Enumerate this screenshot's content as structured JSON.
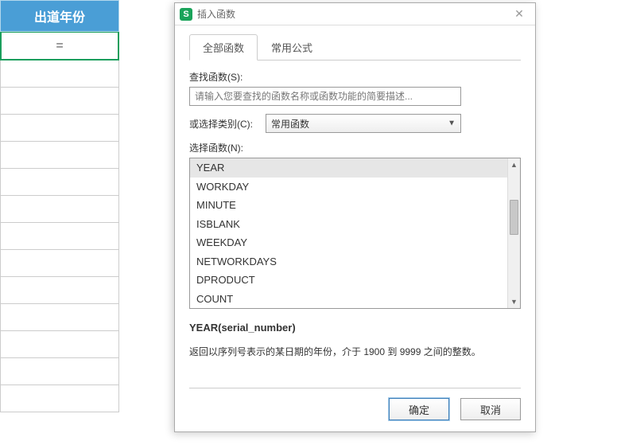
{
  "sheet": {
    "header": "出道年份",
    "formula": "="
  },
  "dialog": {
    "title": "插入函数",
    "tabs": {
      "all": "全部函数",
      "common": "常用公式"
    },
    "search_label": "查找函数(S):",
    "search_placeholder": "请输入您要查找的函数名称或函数功能的简要描述...",
    "category_label": "或选择类别(C):",
    "category_value": "常用函数",
    "list_label": "选择函数(N):",
    "functions": [
      "YEAR",
      "WORKDAY",
      "MINUTE",
      "ISBLANK",
      "WEEKDAY",
      "NETWORKDAYS",
      "DPRODUCT",
      "COUNT"
    ],
    "syntax": "YEAR(serial_number)",
    "description": "返回以序列号表示的某日期的年份，介于 1900 到 9999 之间的整数。",
    "ok": "确定",
    "cancel": "取消"
  }
}
